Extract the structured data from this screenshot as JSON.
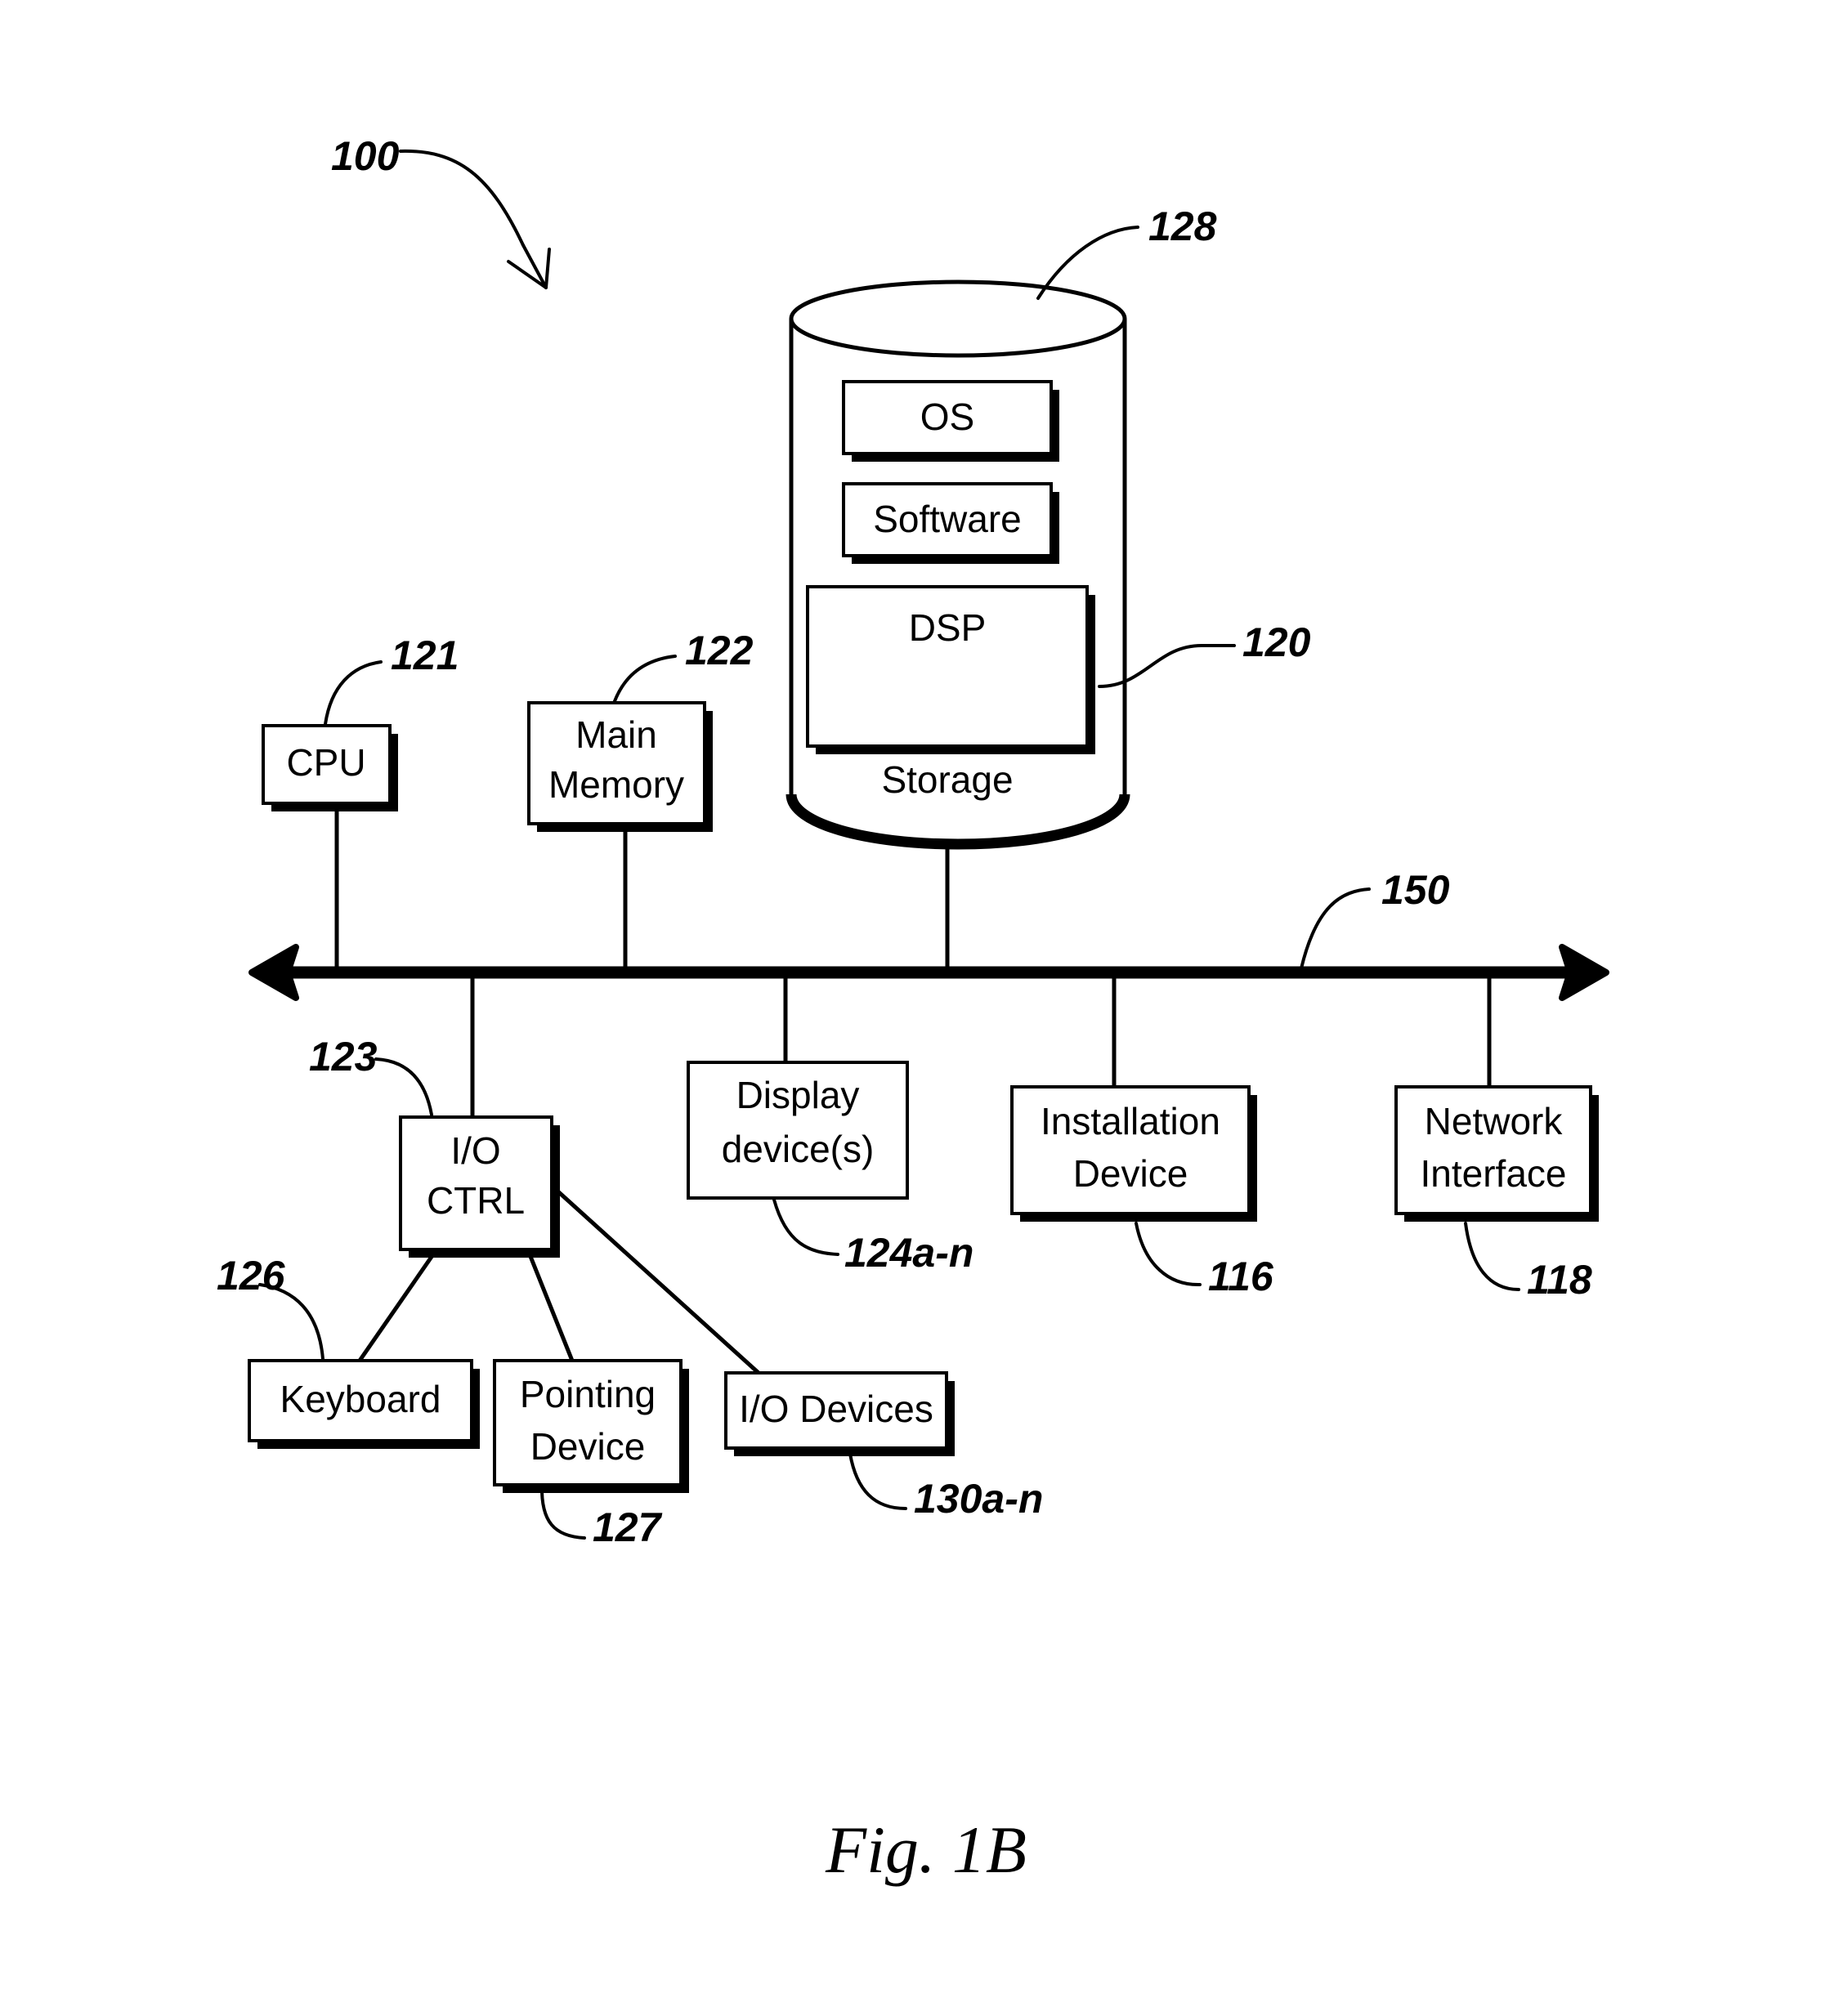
{
  "figure": {
    "caption": "Fig. 1B",
    "system_ref": "100"
  },
  "storage": {
    "label": "Storage",
    "ref": "128",
    "contents_ref": "120",
    "items": [
      {
        "label": "OS"
      },
      {
        "label": "Software"
      },
      {
        "label": "DSP"
      }
    ]
  },
  "bus": {
    "ref": "150"
  },
  "components": {
    "cpu": {
      "label": "CPU",
      "ref": "121"
    },
    "main_memory": {
      "label": "Main\nMemory",
      "line1": "Main",
      "line2": "Memory",
      "ref": "122"
    },
    "io_ctrl": {
      "line1": "I/O",
      "line2": "CTRL",
      "ref": "123"
    },
    "display_devices": {
      "line1": "Display",
      "line2": "device(s)",
      "ref": "124a-n"
    },
    "installation_device": {
      "line1": "Installation",
      "line2": "Device",
      "ref": "116"
    },
    "network_interface": {
      "line1": "Network",
      "line2": "Interface",
      "ref": "118"
    },
    "keyboard": {
      "label": "Keyboard",
      "ref": "126"
    },
    "pointing_device": {
      "line1": "Pointing",
      "line2": "Device",
      "ref": "127"
    },
    "io_devices": {
      "label": "I/O Devices",
      "ref": "130a-n"
    }
  },
  "colors": {
    "ink": "#000000",
    "paper": "#ffffff"
  }
}
